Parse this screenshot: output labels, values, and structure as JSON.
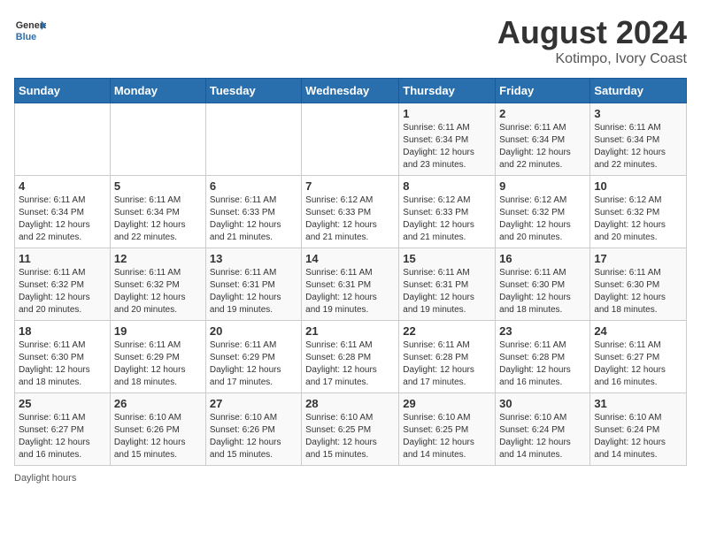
{
  "header": {
    "logo_line1": "General",
    "logo_line2": "Blue",
    "title": "August 2024",
    "subtitle": "Kotimpo, Ivory Coast"
  },
  "footer": {
    "daylight_label": "Daylight hours"
  },
  "days_of_week": [
    "Sunday",
    "Monday",
    "Tuesday",
    "Wednesday",
    "Thursday",
    "Friday",
    "Saturday"
  ],
  "weeks": [
    [
      {
        "day": "",
        "info": ""
      },
      {
        "day": "",
        "info": ""
      },
      {
        "day": "",
        "info": ""
      },
      {
        "day": "",
        "info": ""
      },
      {
        "day": "1",
        "info": "Sunrise: 6:11 AM\nSunset: 6:34 PM\nDaylight: 12 hours\nand 23 minutes."
      },
      {
        "day": "2",
        "info": "Sunrise: 6:11 AM\nSunset: 6:34 PM\nDaylight: 12 hours\nand 22 minutes."
      },
      {
        "day": "3",
        "info": "Sunrise: 6:11 AM\nSunset: 6:34 PM\nDaylight: 12 hours\nand 22 minutes."
      }
    ],
    [
      {
        "day": "4",
        "info": "Sunrise: 6:11 AM\nSunset: 6:34 PM\nDaylight: 12 hours\nand 22 minutes."
      },
      {
        "day": "5",
        "info": "Sunrise: 6:11 AM\nSunset: 6:34 PM\nDaylight: 12 hours\nand 22 minutes."
      },
      {
        "day": "6",
        "info": "Sunrise: 6:11 AM\nSunset: 6:33 PM\nDaylight: 12 hours\nand 21 minutes."
      },
      {
        "day": "7",
        "info": "Sunrise: 6:12 AM\nSunset: 6:33 PM\nDaylight: 12 hours\nand 21 minutes."
      },
      {
        "day": "8",
        "info": "Sunrise: 6:12 AM\nSunset: 6:33 PM\nDaylight: 12 hours\nand 21 minutes."
      },
      {
        "day": "9",
        "info": "Sunrise: 6:12 AM\nSunset: 6:32 PM\nDaylight: 12 hours\nand 20 minutes."
      },
      {
        "day": "10",
        "info": "Sunrise: 6:12 AM\nSunset: 6:32 PM\nDaylight: 12 hours\nand 20 minutes."
      }
    ],
    [
      {
        "day": "11",
        "info": "Sunrise: 6:11 AM\nSunset: 6:32 PM\nDaylight: 12 hours\nand 20 minutes."
      },
      {
        "day": "12",
        "info": "Sunrise: 6:11 AM\nSunset: 6:32 PM\nDaylight: 12 hours\nand 20 minutes."
      },
      {
        "day": "13",
        "info": "Sunrise: 6:11 AM\nSunset: 6:31 PM\nDaylight: 12 hours\nand 19 minutes."
      },
      {
        "day": "14",
        "info": "Sunrise: 6:11 AM\nSunset: 6:31 PM\nDaylight: 12 hours\nand 19 minutes."
      },
      {
        "day": "15",
        "info": "Sunrise: 6:11 AM\nSunset: 6:31 PM\nDaylight: 12 hours\nand 19 minutes."
      },
      {
        "day": "16",
        "info": "Sunrise: 6:11 AM\nSunset: 6:30 PM\nDaylight: 12 hours\nand 18 minutes."
      },
      {
        "day": "17",
        "info": "Sunrise: 6:11 AM\nSunset: 6:30 PM\nDaylight: 12 hours\nand 18 minutes."
      }
    ],
    [
      {
        "day": "18",
        "info": "Sunrise: 6:11 AM\nSunset: 6:30 PM\nDaylight: 12 hours\nand 18 minutes."
      },
      {
        "day": "19",
        "info": "Sunrise: 6:11 AM\nSunset: 6:29 PM\nDaylight: 12 hours\nand 18 minutes."
      },
      {
        "day": "20",
        "info": "Sunrise: 6:11 AM\nSunset: 6:29 PM\nDaylight: 12 hours\nand 17 minutes."
      },
      {
        "day": "21",
        "info": "Sunrise: 6:11 AM\nSunset: 6:28 PM\nDaylight: 12 hours\nand 17 minutes."
      },
      {
        "day": "22",
        "info": "Sunrise: 6:11 AM\nSunset: 6:28 PM\nDaylight: 12 hours\nand 17 minutes."
      },
      {
        "day": "23",
        "info": "Sunrise: 6:11 AM\nSunset: 6:28 PM\nDaylight: 12 hours\nand 16 minutes."
      },
      {
        "day": "24",
        "info": "Sunrise: 6:11 AM\nSunset: 6:27 PM\nDaylight: 12 hours\nand 16 minutes."
      }
    ],
    [
      {
        "day": "25",
        "info": "Sunrise: 6:11 AM\nSunset: 6:27 PM\nDaylight: 12 hours\nand 16 minutes."
      },
      {
        "day": "26",
        "info": "Sunrise: 6:10 AM\nSunset: 6:26 PM\nDaylight: 12 hours\nand 15 minutes."
      },
      {
        "day": "27",
        "info": "Sunrise: 6:10 AM\nSunset: 6:26 PM\nDaylight: 12 hours\nand 15 minutes."
      },
      {
        "day": "28",
        "info": "Sunrise: 6:10 AM\nSunset: 6:25 PM\nDaylight: 12 hours\nand 15 minutes."
      },
      {
        "day": "29",
        "info": "Sunrise: 6:10 AM\nSunset: 6:25 PM\nDaylight: 12 hours\nand 14 minutes."
      },
      {
        "day": "30",
        "info": "Sunrise: 6:10 AM\nSunset: 6:24 PM\nDaylight: 12 hours\nand 14 minutes."
      },
      {
        "day": "31",
        "info": "Sunrise: 6:10 AM\nSunset: 6:24 PM\nDaylight: 12 hours\nand 14 minutes."
      }
    ]
  ]
}
